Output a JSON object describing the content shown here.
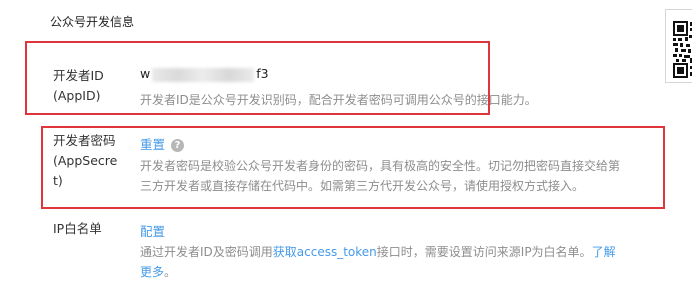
{
  "section_title": "公众号开发信息",
  "developer_id": {
    "label_line1": "开发者ID",
    "label_line2": "(AppID)",
    "value_prefix": "w",
    "value_suffix": "f3",
    "description": "开发者ID是公众号开发识别码，配合开发者密码可调用公众号的接口能力。"
  },
  "developer_secret": {
    "label_line1": "开发者密码",
    "label_line2": "(AppSecre",
    "label_line3": "t)",
    "reset_link": "重置",
    "help_glyph": "?",
    "description_line1": "开发者密码是校验公众号开发者身份的密码，具有极高的安全性。切记勿把密码直接交给第",
    "description_line2": "三方开发者或直接存储在代码中。如需第三方代开发公众号，请使用授权方式接入。"
  },
  "ip_whitelist": {
    "label": "IP白名单",
    "config_link": "配置",
    "description_before": "通过开发者ID及密码调用",
    "description_link": "获取access_token",
    "description_after": "接口时，需要设置访问来源IP为白名单。",
    "learn_more_part1": "了解",
    "learn_more_part2": "更多",
    "description_end": "。"
  },
  "colors": {
    "link": "#459ae9",
    "highlight_box": "#e0363b",
    "description_text": "#8d8d8d"
  },
  "icons": {
    "help": "question-circle-icon",
    "qr": "qr-code-icon"
  }
}
